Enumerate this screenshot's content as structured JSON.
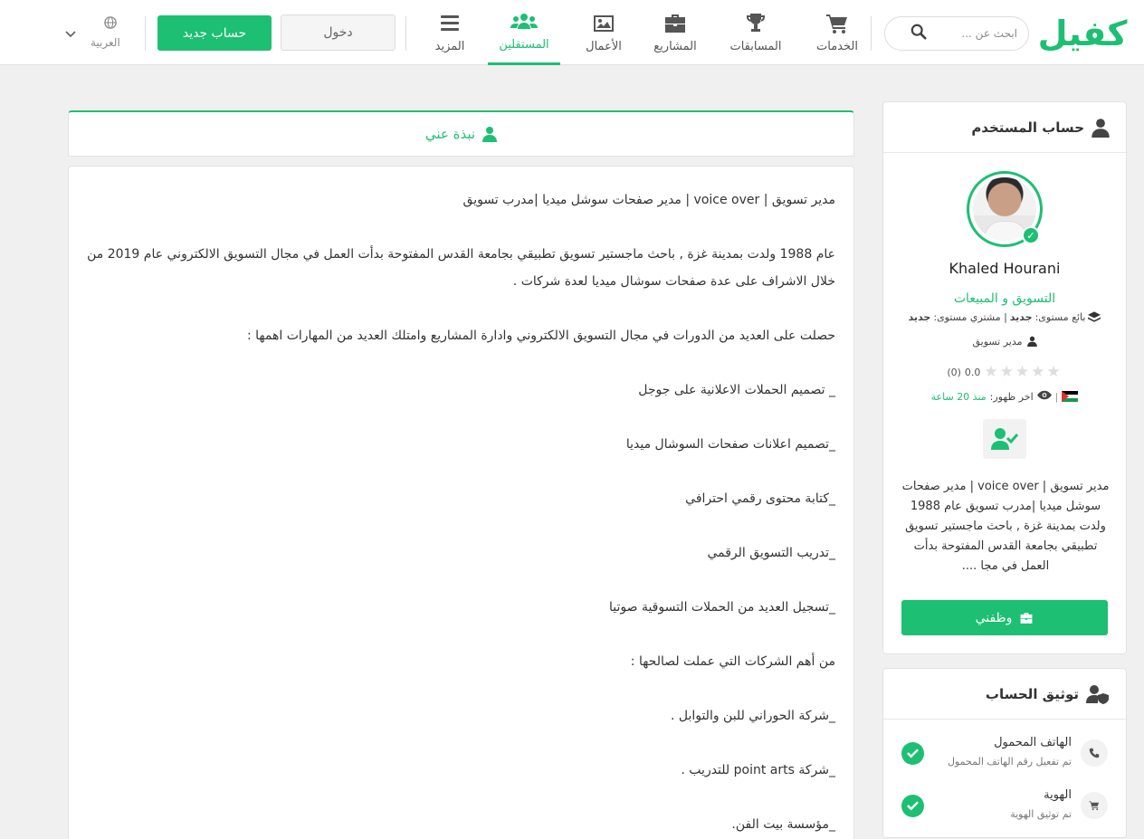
{
  "header": {
    "logo_text": "كفيل",
    "search_placeholder": "ابحث عن ...",
    "nav": [
      {
        "label": "الخدمات",
        "icon": "cart-icon"
      },
      {
        "label": "المسابقات",
        "icon": "trophy-icon"
      },
      {
        "label": "المشاريع",
        "icon": "briefcase-icon"
      },
      {
        "label": "الأعمال",
        "icon": "image-icon"
      },
      {
        "label": "المستقلين",
        "icon": "users-icon",
        "active": true
      },
      {
        "label": "المزيد",
        "icon": "menu-icon"
      }
    ],
    "login_label": "دخول",
    "register_label": "حساب جديد",
    "language_label": "العربية"
  },
  "about_tab": {
    "label": "نبذة عني"
  },
  "about": {
    "paragraphs": [
      "مدير تسويق | voice over | مدير صفحات سوشل ميديا |مدرب تسويق",
      "عام 1988 ولدت بمدينة غزة , باحث ماجستير تسويق تطبيقي بجامعة القدس المفتوحة بدأت العمل في مجال التسويق الالكتروني عام 2019 من خلال الاشراف على عدة صفحات سوشال ميديا لعدة شركات .",
      "حصلت على العديد من الدورات في مجال التسويق الالكتروني وادارة المشاريع وامتلك العديد من المهارات اهمها :",
      "_ تصميم الحملات الاعلانية على جوجل",
      "_تصميم اعلانات صفحات السوشال ميديا",
      "_كتابة محتوى رقمي احترافي",
      "_تدريب التسويق الرقمي",
      "_تسجيل العديد من الحملات التسوقية صوتيا",
      "من أهم الشركات التي عملت لصالحها :",
      "_شركة الحوراني للبن والتوابل .",
      "_شركة point arts للتدريب .",
      "_مؤسسة بيت الفن."
    ]
  },
  "user_card": {
    "title": "حساب المستخدم",
    "name": "Khaled Hourani",
    "category": "التسويق و المبيعات",
    "level_prefix": "بائع مستوى:",
    "seller_level": "جديد",
    "level_sep": "| مشتري مستوى:",
    "buyer_level": "جديد",
    "job_title": "مدير تسويق",
    "rating": "0.0",
    "rating_count": "(0)",
    "rating_stars": 0,
    "last_seen_label": "اخر ظهور:",
    "last_seen_value": "منذ 20 ساعة",
    "bio_excerpt": "مدير تسويق | voice over | مدير صفحات سوشل ميديا |مدرب تسويق عام 1988 ولدت بمدينة غزة , باحث ماجستير تسويق تطبيقي بجامعة القدس المفتوحة بدأت العمل في مجا ....",
    "hire_label": "وظفني"
  },
  "verification": {
    "title": "توثيق الحساب",
    "items": [
      {
        "title": "الهاتف المحمول",
        "subtitle": "تم تفعيل رقم الهاتف المحمول",
        "icon": "phone-icon"
      },
      {
        "title": "الهوية",
        "subtitle": "تم توثيق الهوية",
        "icon": "cart-icon"
      }
    ]
  },
  "colors": {
    "accent": "#1dbf73",
    "background": "#f0f0f0"
  }
}
